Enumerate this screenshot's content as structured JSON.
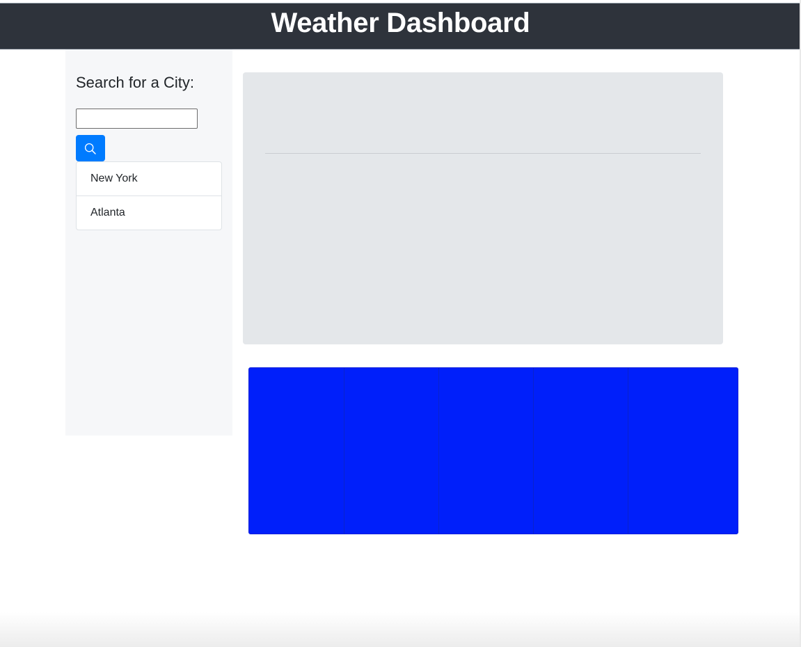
{
  "header": {
    "title": "Weather Dashboard",
    "background_color": "#2e333b"
  },
  "sidebar": {
    "heading": "Search for a City:",
    "search": {
      "value": "",
      "placeholder": "",
      "button_icon": "search-icon",
      "button_color": "#007bff"
    },
    "cities": [
      {
        "label": "New York"
      },
      {
        "label": "Atlanta"
      }
    ]
  },
  "current_weather": {
    "background_color": "#e4e7ea"
  },
  "forecast": {
    "background_color": "#001ffa",
    "card_count": 5
  }
}
